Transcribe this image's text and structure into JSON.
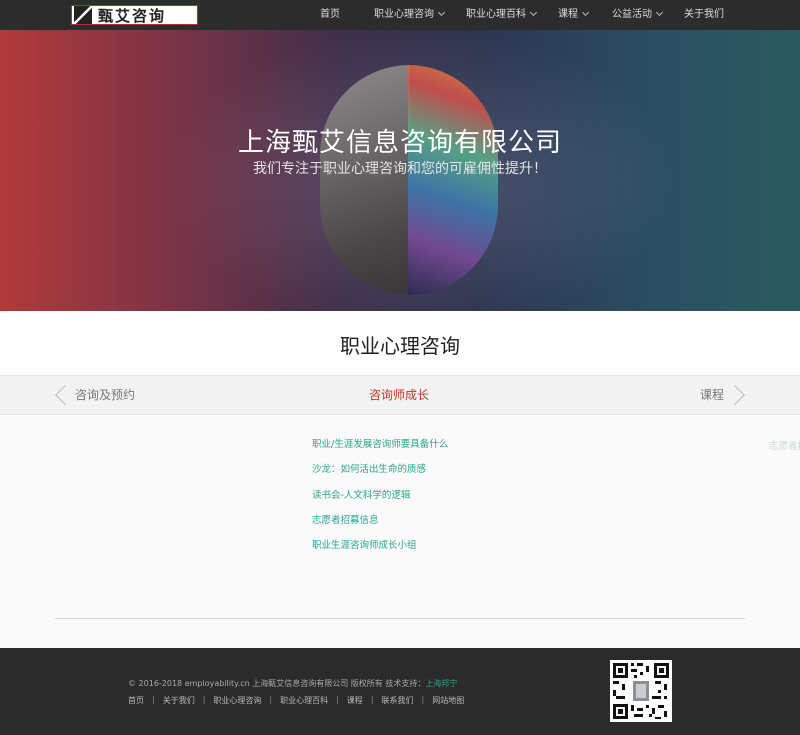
{
  "logo": {
    "text": "甄艾咨询"
  },
  "nav": {
    "items": [
      {
        "label": "首页",
        "has_dropdown": false
      },
      {
        "label": "职业心理咨询",
        "has_dropdown": true
      },
      {
        "label": "职业心理百科",
        "has_dropdown": true
      },
      {
        "label": "课程",
        "has_dropdown": true
      },
      {
        "label": "公益活动",
        "has_dropdown": true
      },
      {
        "label": "关于我们",
        "has_dropdown": false
      }
    ]
  },
  "hero": {
    "title": "上海甄艾信息咨询有限公司",
    "subtitle": "我们专注于职业心理咨询和您的可雇佣性提升！"
  },
  "section": {
    "title": "职业心理咨询",
    "tabs": {
      "prev": "咨询及预约",
      "active": "咨询师成长",
      "next": "课程"
    }
  },
  "articles": [
    "职业/生涯发展咨询师要具备什么",
    "沙龙：如何活出生命的质感",
    "读书会-人文科学的逻辑",
    "志愿者招募信息",
    "职业生涯咨询师成长小组"
  ],
  "ghost_item": "志愿者招",
  "footer": {
    "copyright": "© 2016-2018 employability.cn 上海甄艾信息咨询有限公司 版权所有 技术支持：",
    "tech_support": "上海邦宁",
    "links": [
      "首页",
      "关于我们",
      "职业心理咨询",
      "职业心理百科",
      "课程",
      "联系我们",
      "网站地图"
    ]
  },
  "colors": {
    "accent_green": "#2aa68c",
    "active_red": "#c0392b",
    "nav_bg": "#2c2c2c",
    "footer_bg": "#2b2b2b"
  }
}
